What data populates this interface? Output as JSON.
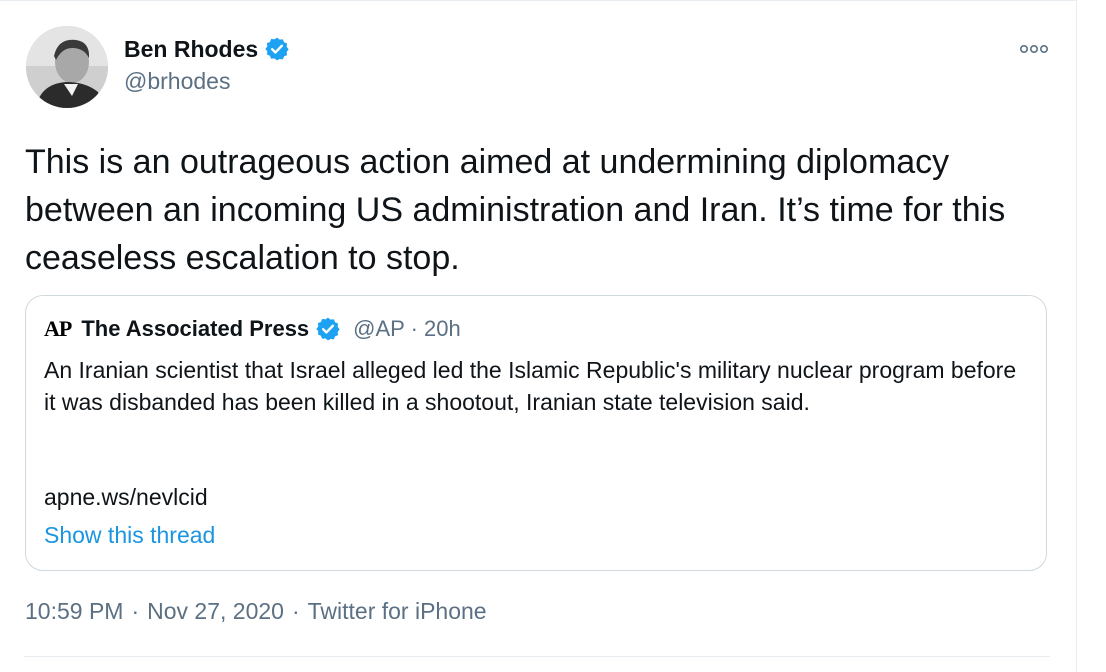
{
  "author": {
    "display_name": "Ben Rhodes",
    "handle": "@brhodes",
    "verified": true
  },
  "tweet": {
    "text": "This is an outrageous action aimed at undermining diplomacy between an incoming US administration and Iran. It’s time for this ceaseless escalation to stop."
  },
  "quoted_tweet": {
    "logo_text": "AP",
    "display_name": "The Associated Press",
    "verified": true,
    "handle": "@AP",
    "separator": "·",
    "time_ago": "20h",
    "text": "An Iranian scientist that Israel alleged led the Islamic Republic's military nuclear program before it was disbanded has been killed in a shootout, Iranian state television said.",
    "link": "apne.ws/nevlcid",
    "show_thread_label": "Show this thread"
  },
  "footer": {
    "time": "10:59 PM",
    "separator": "·",
    "date": "Nov 27, 2020",
    "source": "Twitter for iPhone"
  },
  "colors": {
    "verified_blue": "#1da1f2",
    "link_blue": "#1b95e0",
    "secondary_text": "#5b7083",
    "border": "#cfd9de"
  },
  "icons": {
    "verified": "verified-badge-icon",
    "more": "more-options-icon"
  }
}
